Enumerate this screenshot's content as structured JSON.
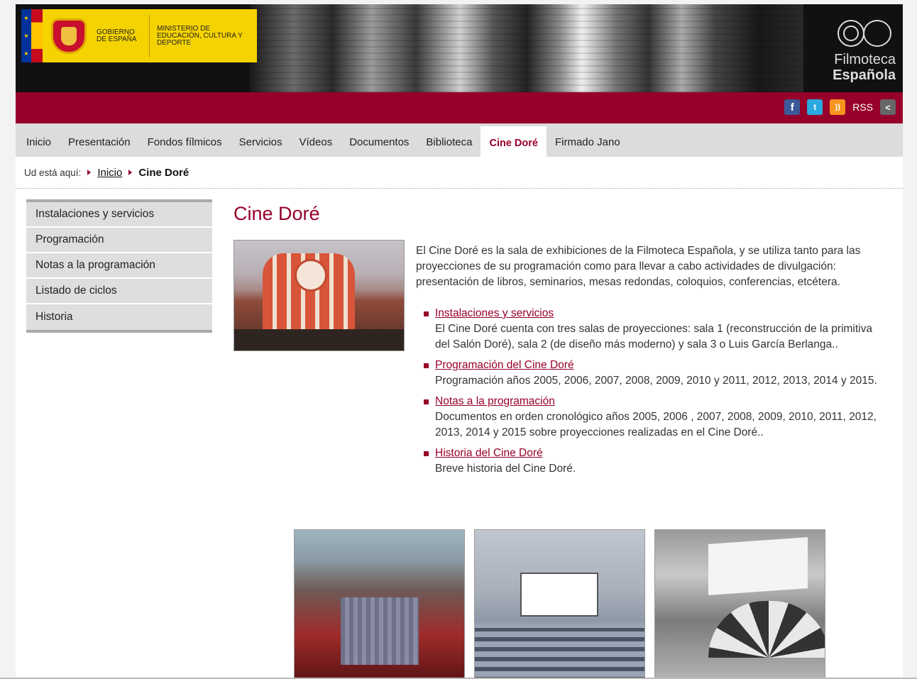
{
  "header": {
    "gov_line": "GOBIERNO DE ESPAÑA",
    "ministry_line": "MINISTERIO DE EDUCACIÓN, CULTURA Y DEPORTE",
    "brand_line1": "Filmoteca",
    "brand_line2": "Española",
    "social": {
      "facebook": "f",
      "twitter": "t",
      "rss_icon": "))",
      "rss_label": "RSS",
      "share": "<"
    }
  },
  "nav": {
    "items": [
      {
        "label": "Inicio"
      },
      {
        "label": "Presentación"
      },
      {
        "label": "Fondos fílmicos"
      },
      {
        "label": "Servicios"
      },
      {
        "label": "Vídeos"
      },
      {
        "label": "Documentos"
      },
      {
        "label": "Biblioteca"
      },
      {
        "label": "Cine Doré"
      },
      {
        "label": "Firmado Jano"
      }
    ],
    "active": "Cine Doré"
  },
  "breadcrumb": {
    "prefix": "Ud está aquí:",
    "home": "Inicio",
    "current": "Cine Doré"
  },
  "sidebar": {
    "items": [
      {
        "label": "Instalaciones y servicios"
      },
      {
        "label": "Programación"
      },
      {
        "label": "Notas a la programación"
      },
      {
        "label": "Listado de ciclos"
      },
      {
        "label": "Historia"
      }
    ]
  },
  "main": {
    "title": "Cine Doré",
    "intro": "El Cine Doré es la sala de exhibiciones de la Filmoteca Española, y se utiliza tanto para las proyecciones de su programación como para llevar a cabo actividades de divulgación: presentación de libros, seminarios, mesas redondas, coloquios, conferencias, etcétera.",
    "links": [
      {
        "title": "Instalaciones y servicios",
        "desc": "El Cine Doré cuenta con tres salas de proyecciones: sala 1 (reconstrucción de la primitiva del Salón Doré), sala 2 (de diseño más moderno) y sala 3 o Luis García Berlanga.."
      },
      {
        "title": "Programación del Cine Doré",
        "desc": "Programación años 2005, 2006, 2007, 2008, 2009, 2010 y 2011, 2012, 2013, 2014 y 2015."
      },
      {
        "title": "Notas a la programación",
        "desc": "Documentos en orden cronológico años 2005, 2006 , 2007, 2008, 2009, 2010, 2011, 2012, 2013, 2014 y 2015 sobre proyecciones realizadas en el Cine Doré.."
      },
      {
        "title": "Historia del Cine Doré",
        "desc": "Breve historia del Cine Doré."
      }
    ]
  },
  "colors": {
    "brand": "#96002a",
    "nav_bg": "#dcdcdc",
    "sidebar_bg": "#dedede"
  }
}
